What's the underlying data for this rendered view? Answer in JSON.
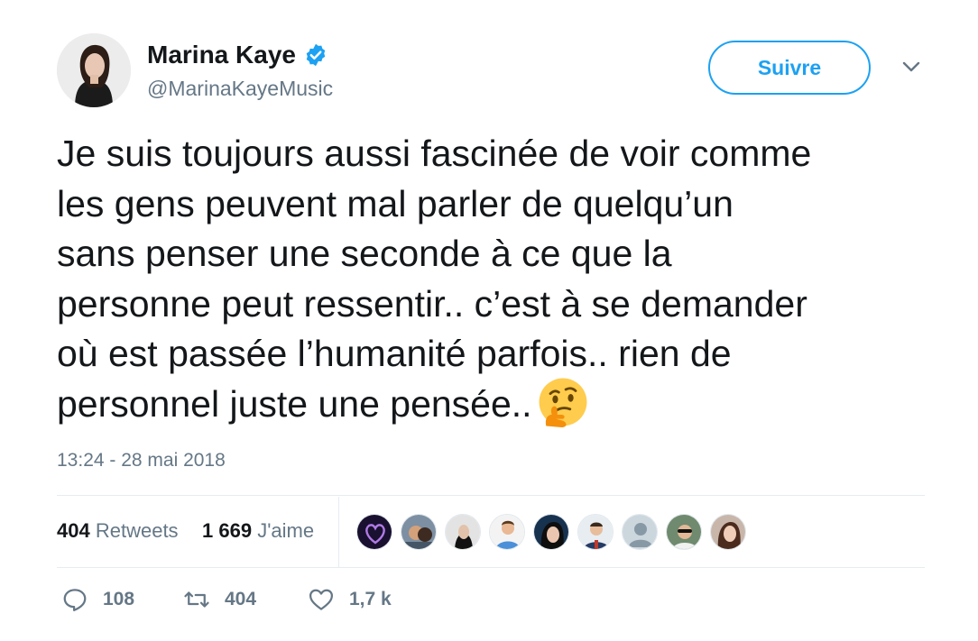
{
  "user": {
    "name": "Marina Kaye",
    "handle": "@MarinaKayeMusic",
    "verified": true
  },
  "follow_label": "Suivre",
  "tweet": {
    "text": "Je suis toujours aussi fascinée de voir comme\nles gens peuvent mal parler de quelqu’un\nsans penser une seconde à ce que la\npersonne peut ressentir.. c’est à se demander\noù est passée l’humanité parfois.. rien de\npersonnel juste une pensée..",
    "emoji": "thinking-face"
  },
  "timestamp": "13:24 - 28 mai 2018",
  "stats": {
    "retweets_count": "404",
    "retweets_label": "Retweets",
    "likes_count": "1 669",
    "likes_label": "J'aime"
  },
  "actions": {
    "replies": "108",
    "retweets": "404",
    "likes": "1,7 k"
  },
  "colors": {
    "accent": "#1da1f2",
    "text": "#14171a",
    "muted": "#657786"
  }
}
